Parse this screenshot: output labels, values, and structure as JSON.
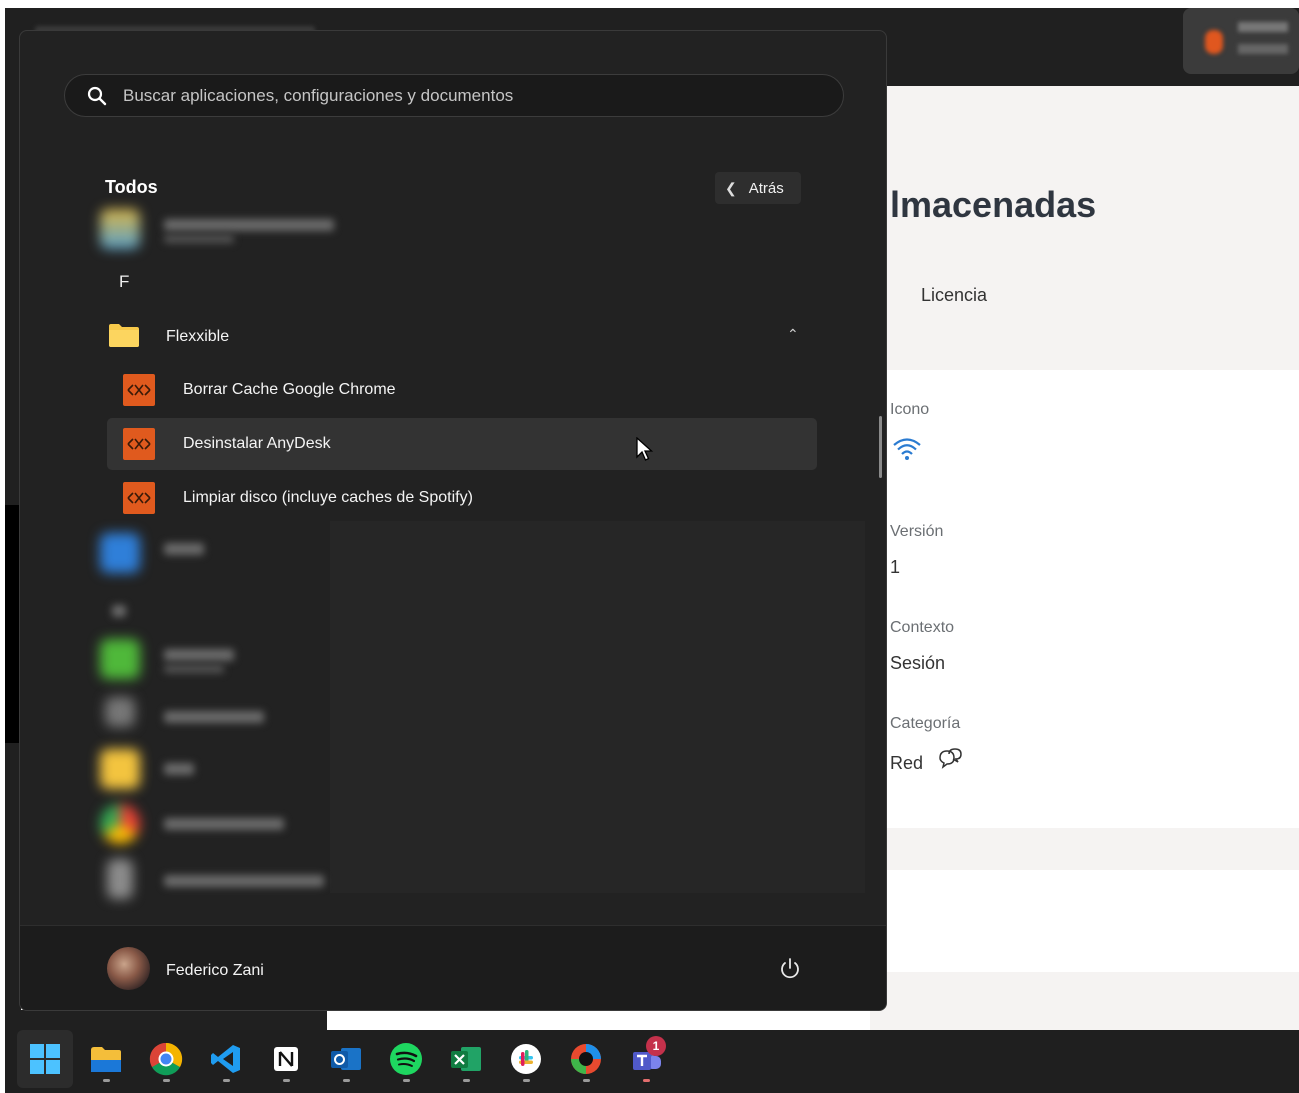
{
  "background_app": {
    "title": "lmacenadas",
    "tab": "Licencia",
    "fields": [
      {
        "label": "Icono",
        "value": ""
      },
      {
        "label": "Versión",
        "value": "1"
      },
      {
        "label": "Contexto",
        "value": "Sesión"
      },
      {
        "label": "Categoría",
        "value": "Red"
      }
    ]
  },
  "start_menu": {
    "search": {
      "placeholder": "Buscar aplicaciones, configuraciones y documentos",
      "value": ""
    },
    "heading": "Todos",
    "back_label": "Atrás",
    "section_letter": "F",
    "folder": {
      "label": "Flexxible",
      "expanded": true
    },
    "apps": [
      {
        "label": "Borrar Cache Google Chrome"
      },
      {
        "label": "Desinstalar AnyDesk"
      },
      {
        "label": "Limpiar disco (incluye caches de Spotify)"
      }
    ],
    "user": {
      "name": "Federico Zani"
    }
  },
  "taskbar": {
    "items": [
      {
        "icon": "windows-start-icon",
        "active": true
      },
      {
        "icon": "file-explorer-icon"
      },
      {
        "icon": "chrome-icon"
      },
      {
        "icon": "vscode-icon"
      },
      {
        "icon": "notion-icon"
      },
      {
        "icon": "outlook-icon"
      },
      {
        "icon": "spotify-icon"
      },
      {
        "icon": "excel-icon"
      },
      {
        "icon": "slack-icon"
      },
      {
        "icon": "snip-icon"
      },
      {
        "icon": "teams-icon",
        "badge": "1"
      }
    ]
  },
  "colors": {
    "accent": "#e05a1e",
    "menu_bg": "#222222",
    "taskbar_bg": "#1f1f1f",
    "badge": "#c4314b"
  }
}
